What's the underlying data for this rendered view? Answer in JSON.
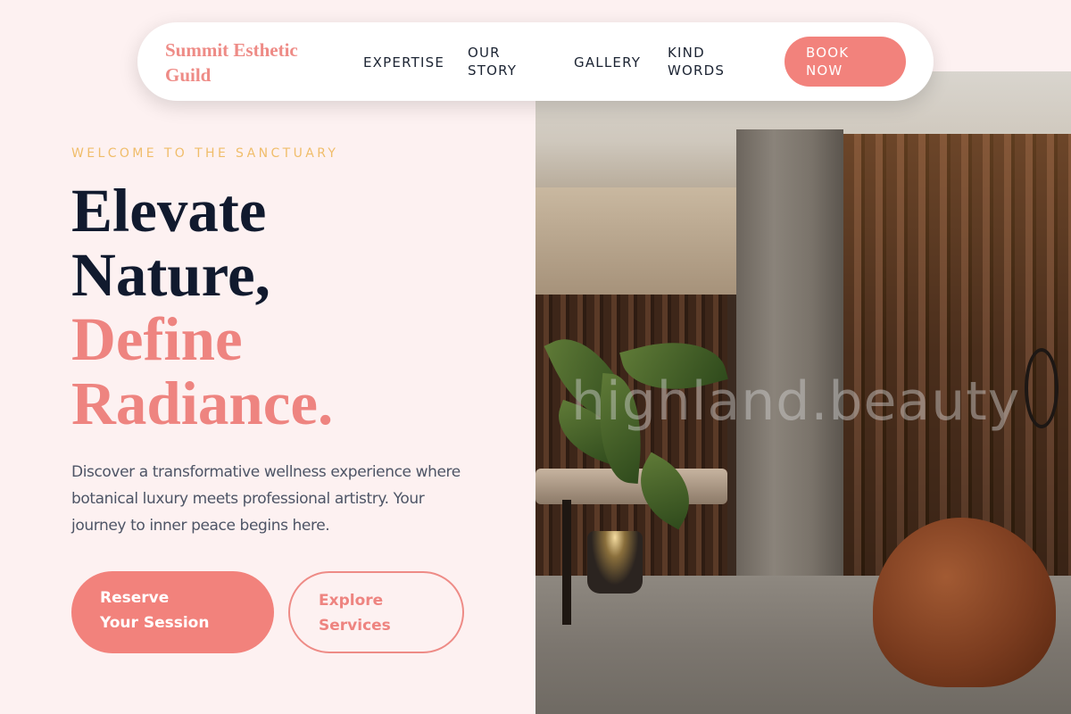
{
  "brand": {
    "name": "Summit Esthetic Guild"
  },
  "nav": {
    "links": [
      {
        "label": "EXPERTISE"
      },
      {
        "label": "OUR STORY"
      },
      {
        "label": "GALLERY"
      },
      {
        "label": "KIND WORDS"
      }
    ],
    "cta_label": "BOOK NOW"
  },
  "hero": {
    "eyebrow": "WELCOME TO THE SANCTUARY",
    "headline_line1": "Elevate",
    "headline_line2": "Nature,",
    "headline_line3": "Define",
    "headline_line4": "Radiance.",
    "lede": "Discover a transformative wellness experience where botanical luxury meets professional artistry. Your journey to inner peace begins here.",
    "primary_button": "Reserve Your Session",
    "secondary_button": "Explore Services"
  },
  "photo": {
    "watermark": "highland.beauty",
    "alt": "spa interior with plant and armchair"
  },
  "colors": {
    "accent": "#f2827c",
    "eyebrow": "#f0bd6a",
    "heading": "#111a2e",
    "background": "#fdf1f1"
  }
}
